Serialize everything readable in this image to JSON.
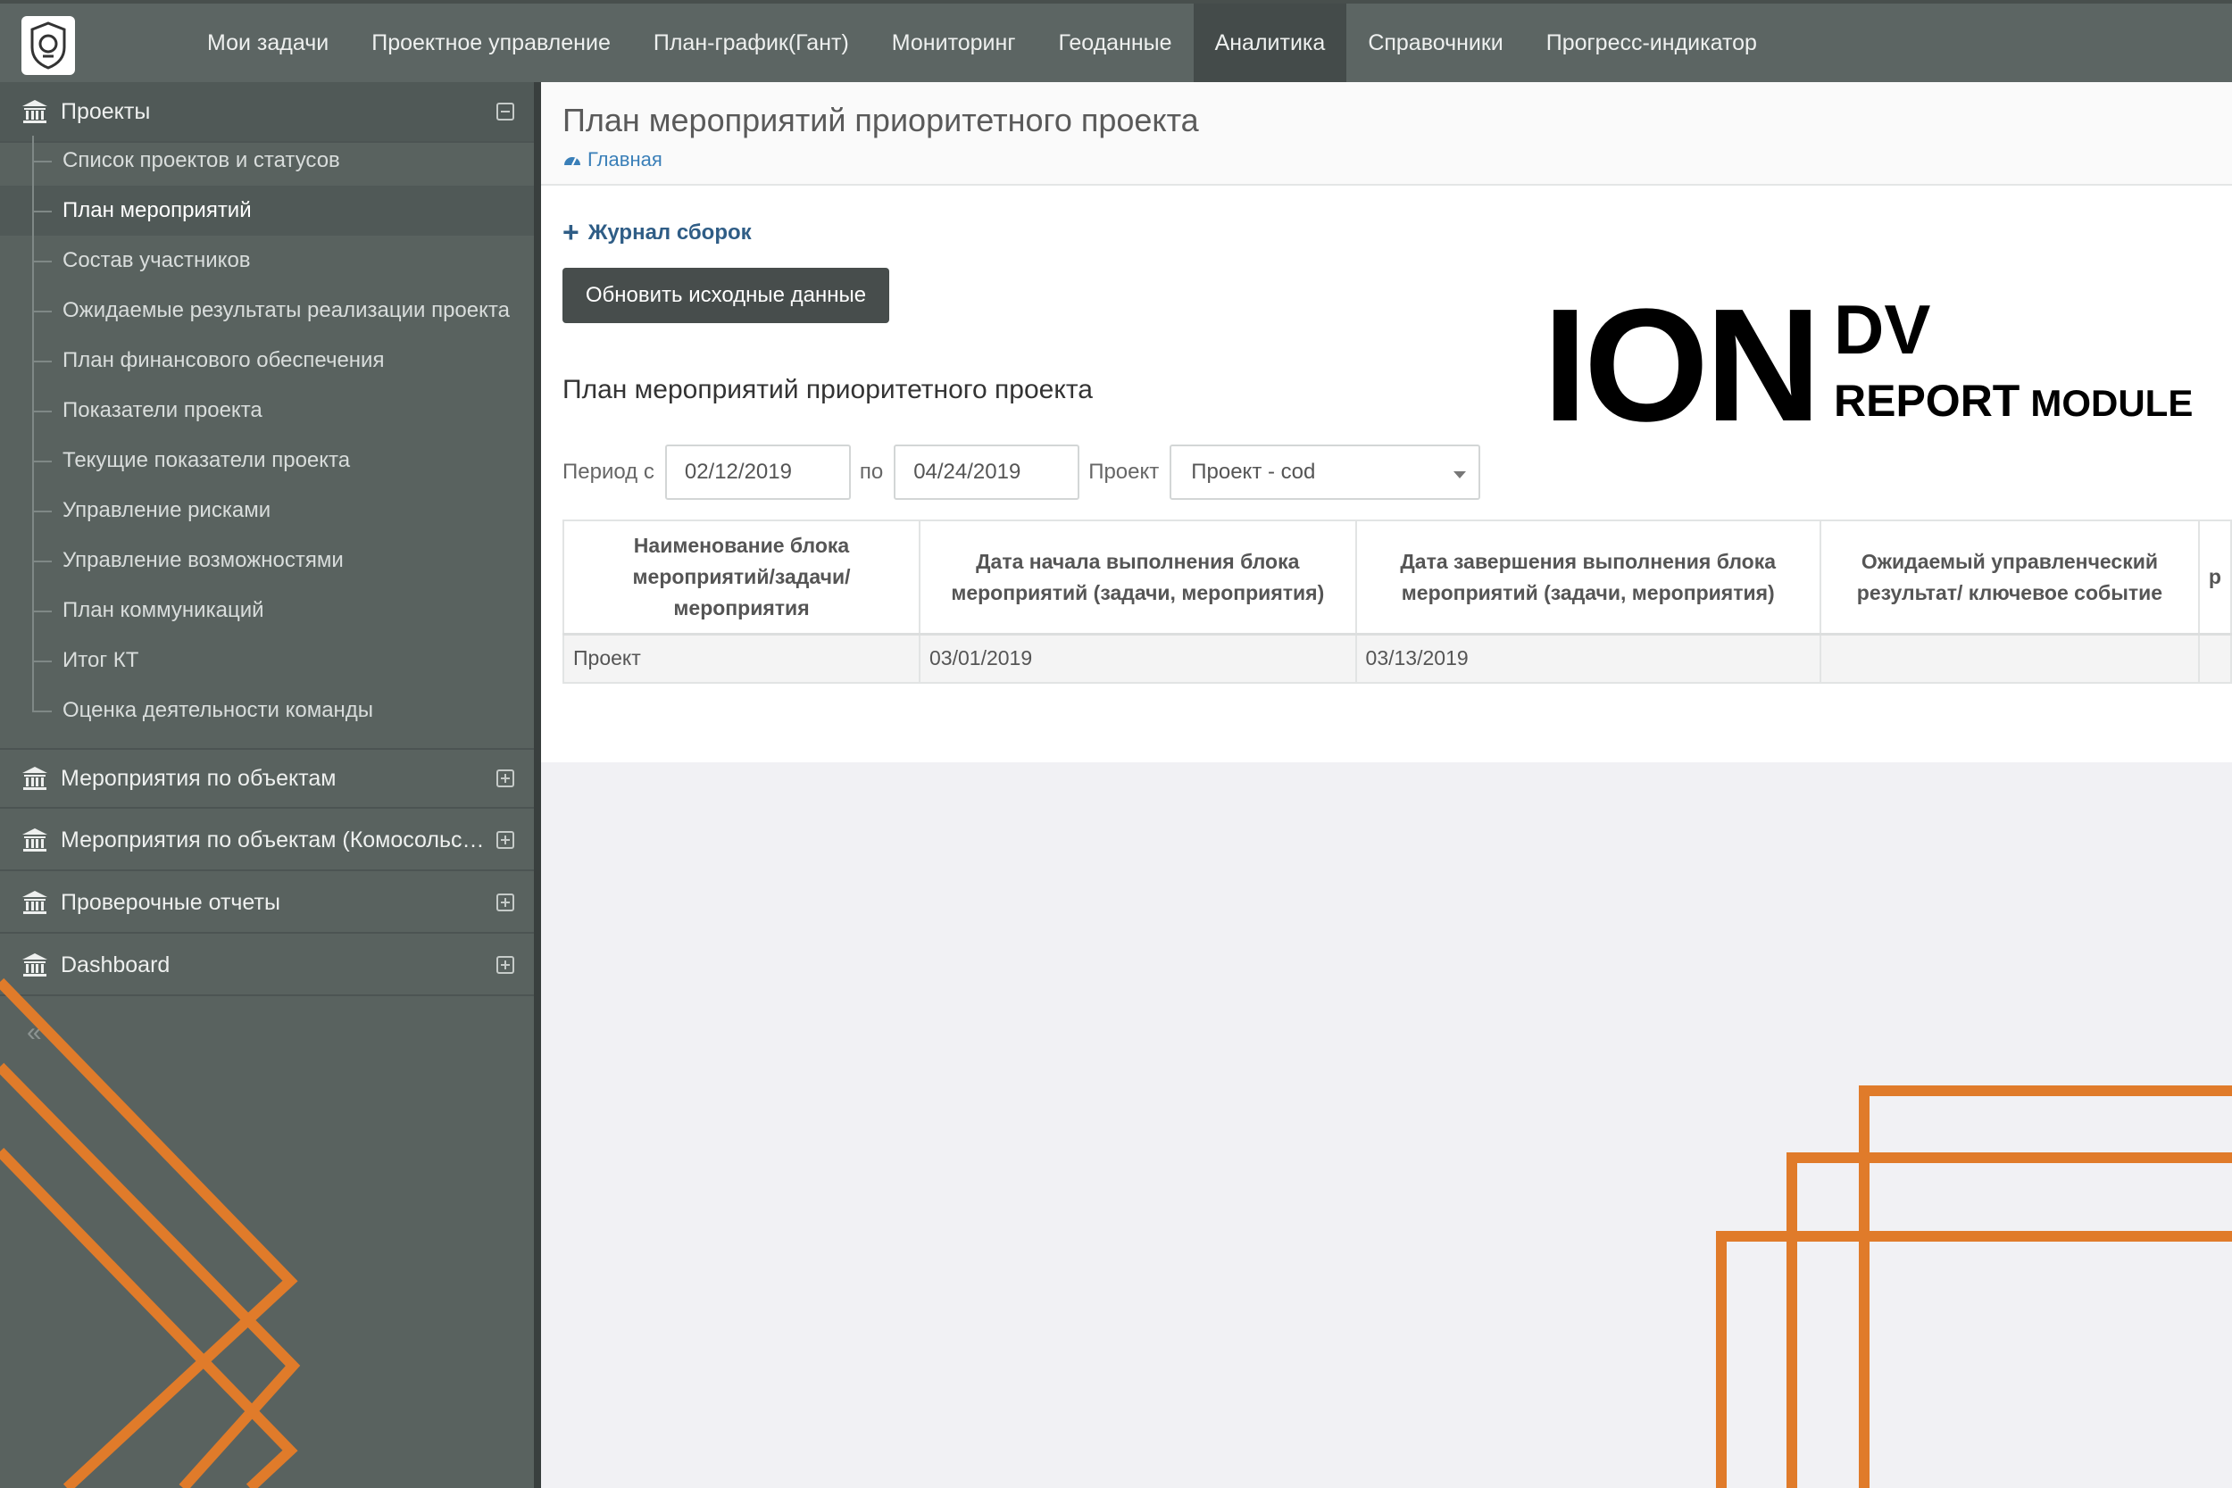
{
  "nav": {
    "items": [
      {
        "label": "Мои задачи",
        "active": false
      },
      {
        "label": "Проектное управление",
        "active": false
      },
      {
        "label": "План-график(Гант)",
        "active": false
      },
      {
        "label": "Мониторинг",
        "active": false
      },
      {
        "label": "Геоданные",
        "active": false
      },
      {
        "label": "Аналитика",
        "active": true
      },
      {
        "label": "Справочники",
        "active": false
      },
      {
        "label": "Прогресс-индикатор",
        "active": false
      }
    ]
  },
  "sidebar": {
    "groups": [
      {
        "label": "Проекты",
        "expanded": true
      },
      {
        "label": "Мероприятия по объектам",
        "expanded": false
      },
      {
        "label": "Мероприятия по объектам (Комосольск-на-Амуре)",
        "expanded": false
      },
      {
        "label": "Проверочные отчеты",
        "expanded": false
      },
      {
        "label": "Dashboard",
        "expanded": false
      }
    ],
    "items": [
      "Список проектов и статусов",
      "План мероприятий",
      "Состав участников",
      "Ожидаемые результаты реализации проекта",
      "План финансового обеспечения",
      "Показатели проекта",
      "Текущие показатели проекта",
      "Управление рисками",
      "Управление возможностями",
      "План коммуникаций",
      "Итог КТ",
      "Оценка деятельности команды"
    ],
    "active_item": "План мероприятий",
    "collapse_glyph": "«"
  },
  "page": {
    "title": "План мероприятий приоритетного проекта",
    "breadcrumb": "Главная",
    "journal_link": "Журнал сборок",
    "refresh_button": "Обновить исходные данные",
    "report_title": "План мероприятий приоритетного проекта"
  },
  "filters": {
    "period_from_label": "Период с",
    "period_from": "02/12/2019",
    "period_to_label": "по",
    "period_to": "04/24/2019",
    "project_label": "Проект",
    "project_value": "Проект - cod"
  },
  "table": {
    "columns": [
      "Наименование блока мероприятий/задачи/ мероприятия",
      "Дата начала выполнения блока мероприятий (задачи, мероприятия)",
      "Дата завершения выполнения блока мероприятий (задачи, мероприятия)",
      "Ожидаемый управленческий результат/ ключевое событие",
      "р"
    ],
    "rows": [
      [
        "Проект",
        "03/01/2019",
        "03/13/2019",
        "",
        ""
      ]
    ]
  },
  "branding": {
    "ion": "ION",
    "dv": "DV",
    "report": "REPORT",
    "module": "MODULE"
  },
  "colors": {
    "topbar": "#5c6563",
    "sidebar": "#59625f",
    "accent_orange": "#e07b2a",
    "link_blue": "#3a7fb8"
  }
}
